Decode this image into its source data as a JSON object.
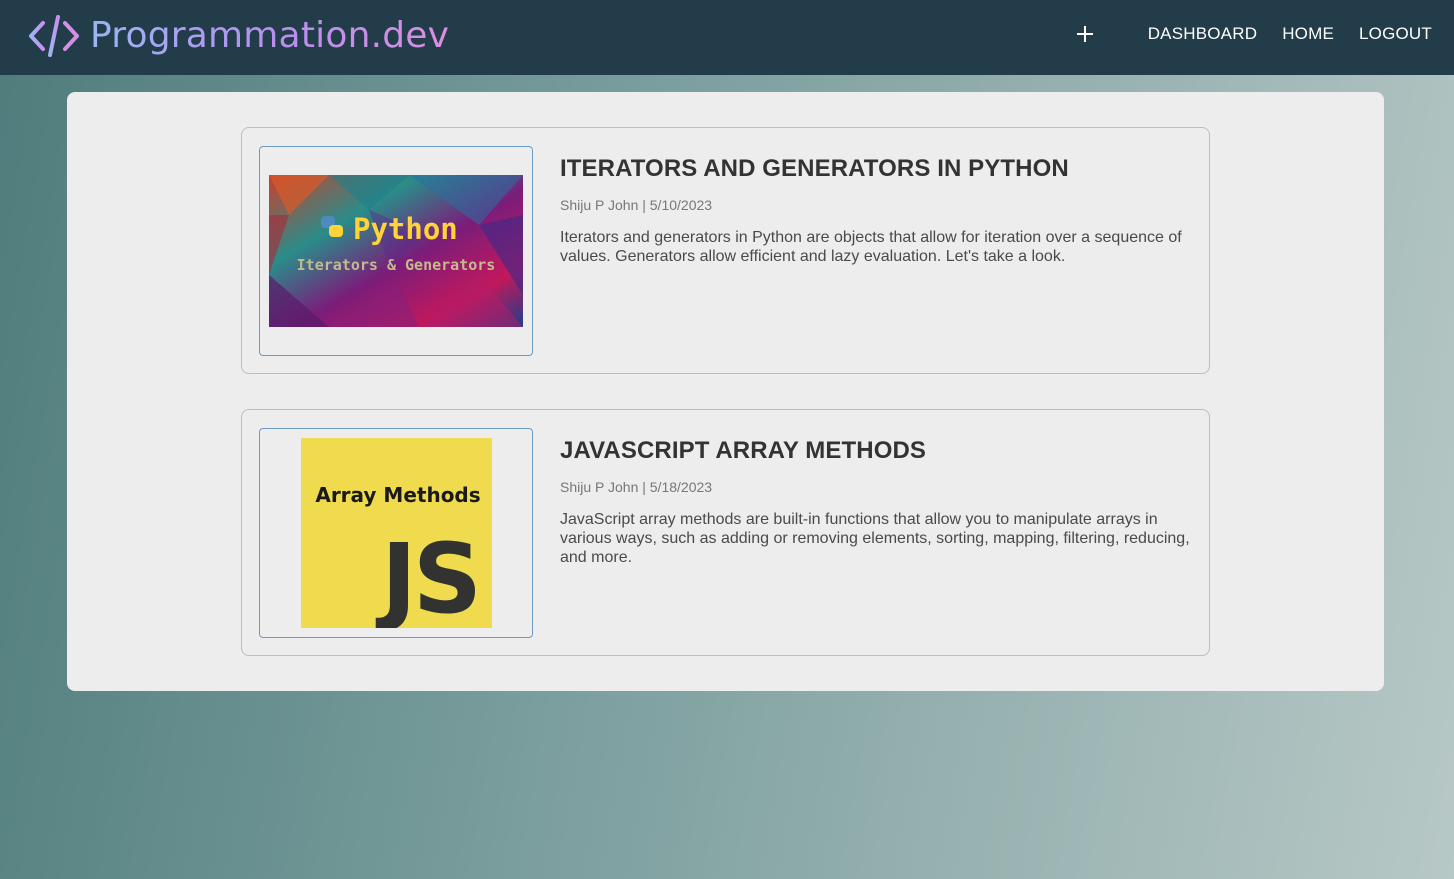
{
  "header": {
    "brand": "Programmation.dev",
    "nav": {
      "dashboard": "DASHBOARD",
      "home": "HOME",
      "logout": "LOGOUT"
    }
  },
  "posts": [
    {
      "title": "ITERATORS AND GENERATORS IN PYTHON",
      "author": "Shiju P John",
      "date": "5/10/2023",
      "meta": "Shiju P John | 5/10/2023",
      "excerpt": "Iterators and generators in Python are objects that allow for iteration over a sequence of values. Generators allow efficient and lazy evaluation. Let's take a look.",
      "thumbnail": {
        "heading": "Python",
        "subheading": "Iterators & Generators"
      }
    },
    {
      "title": "JAVASCRIPT ARRAY METHODS",
      "author": "Shiju P John",
      "date": "5/18/2023",
      "meta": "Shiju P John | 5/18/2023",
      "excerpt": "JavaScript array methods are built-in functions that allow you to manipulate arrays in various ways, such as adding or removing elements, sorting, mapping, filtering, reducing, and more.",
      "thumbnail": {
        "heading": "Array Methods",
        "logo": "JS"
      }
    }
  ],
  "colors": {
    "header_bg": "#223c49",
    "panel_bg": "#ededed",
    "js_yellow": "#f0db4f",
    "thumb_border": "#6c9bc4"
  }
}
